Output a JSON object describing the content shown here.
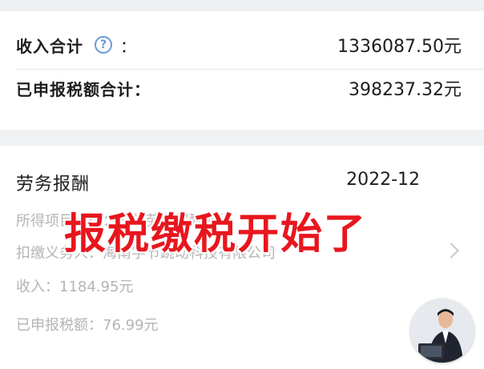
{
  "summary": {
    "income_total_label": "收入合计",
    "income_total_colon": "：",
    "income_total_value": "1336087.50元",
    "tax_total_label": "已申报税额合计：",
    "tax_total_value": "398237.32元"
  },
  "record": {
    "title": "劳务报酬",
    "period": "2022-12",
    "income_item": "所得项目小类：一般劳务报酬所得",
    "withholding_agent": "扣缴义务人：海南字节跳动科技有限公司",
    "income": "收入：1184.95元",
    "tax_declared": "已申报税额：76.99元"
  },
  "overlay_text": "报税缴税开始了",
  "icons": {
    "help": "question-circle-icon",
    "chevron": "chevron-right-icon",
    "avatar": "presenter-avatar"
  },
  "colors": {
    "overlay_red": "#e8161e",
    "help_blue": "#6b9ad8",
    "muted_text": "#b4b4b4"
  }
}
